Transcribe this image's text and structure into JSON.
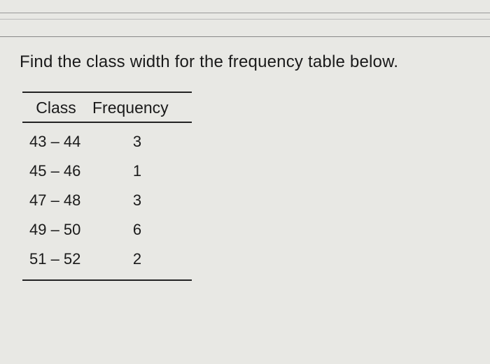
{
  "question": "Find the class width for the frequency table below.",
  "table": {
    "headers": {
      "class": "Class",
      "frequency": "Frequency"
    },
    "rows": [
      {
        "class": "43 – 44",
        "frequency": "3"
      },
      {
        "class": "45 – 46",
        "frequency": "1"
      },
      {
        "class": "47 – 48",
        "frequency": "3"
      },
      {
        "class": "49 – 50",
        "frequency": "6"
      },
      {
        "class": "51 – 52",
        "frequency": "2"
      }
    ]
  }
}
